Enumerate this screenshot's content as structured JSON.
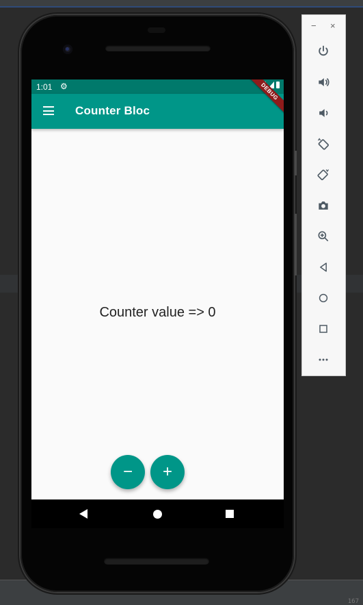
{
  "status_bar": {
    "time": "1:01",
    "color": "#00796b"
  },
  "app_bar": {
    "title": "Counter Bloc",
    "color": "#009688",
    "debug_banner": "DEBUG"
  },
  "body": {
    "counter_text": "Counter value => 0"
  },
  "fabs": {
    "decrement_label": "−",
    "increment_label": "+"
  },
  "emulator_toolbar": {
    "minimize_label": "−",
    "close_label": "×",
    "buttons": [
      "power-icon",
      "volume-up-icon",
      "volume-down-icon",
      "rotate-left-icon",
      "rotate-right-icon",
      "camera-icon",
      "zoom-icon",
      "back-icon",
      "home-icon",
      "overview-icon",
      "more-icon"
    ]
  },
  "ide": {
    "corner_text": "167"
  }
}
